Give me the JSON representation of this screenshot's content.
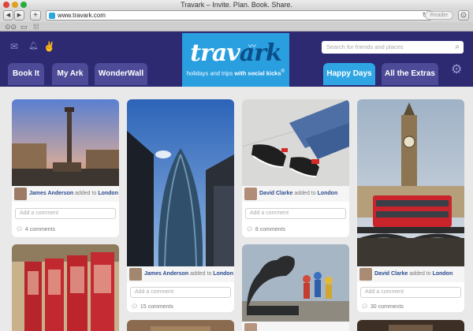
{
  "window": {
    "title": "Travark – Invite. Plan. Book. Share."
  },
  "toolbar": {
    "back": "◀",
    "forward": "▶",
    "add_tab": "+",
    "url": "www.travark.com",
    "reader": "Reader"
  },
  "header": {
    "logo_main": "trav",
    "logo_accent": "ark",
    "tagline_pre": "holidays and trips ",
    "tagline_bold": "with social kicks",
    "tagline_tm": "®",
    "search_placeholder": "Search for friends and places",
    "tabs_left": [
      "Book It",
      "My Ark",
      "WonderWall"
    ],
    "tabs_right": [
      "Happy Days",
      "All the Extras"
    ]
  },
  "posts": [
    {
      "user": "James Anderson",
      "action": "added to",
      "place": "London",
      "comment_placeholder": "Add a comment",
      "comments": "4 comments"
    },
    {
      "user": "James Anderson",
      "action": "added to",
      "place": "London",
      "comment_placeholder": "Add a comment",
      "comments": "15 comments"
    },
    {
      "user": "David Clarke",
      "action": "added to",
      "place": "London",
      "comment_placeholder": "Add a comment",
      "comments": "8 comments"
    },
    {
      "user": "David Clarke",
      "action": "added to",
      "place": "London",
      "comment_placeholder": "Add a comment",
      "comments": "30 comments"
    }
  ],
  "colors": {
    "header_bg": "#2d2a72",
    "tab_bg": "#4d4a98",
    "accent": "#2fa6e3"
  }
}
